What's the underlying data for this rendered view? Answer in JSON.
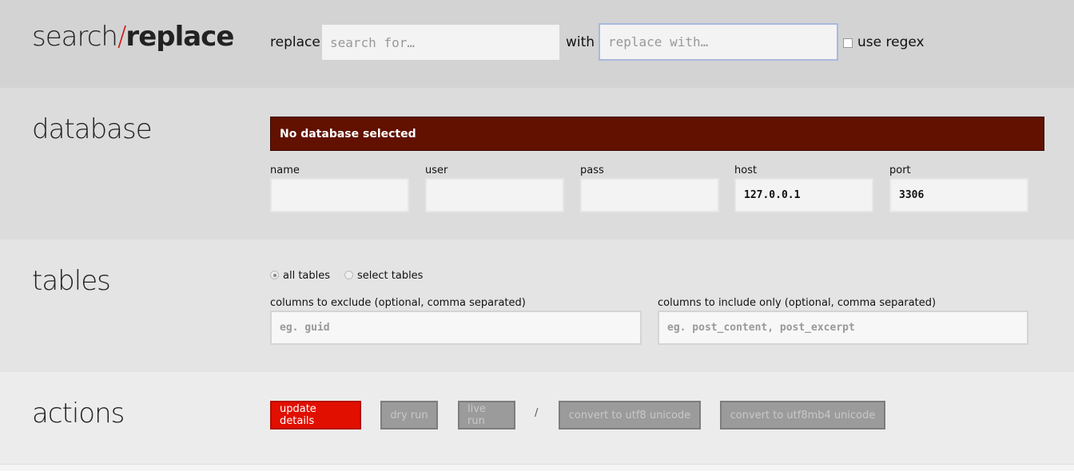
{
  "header": {
    "title_a": "search",
    "title_slash": "/",
    "title_b": "replace",
    "replace_label": "replace",
    "search_placeholder": "search for…",
    "with_label": "with",
    "replace_placeholder": "replace with…",
    "regex_label": "use regex"
  },
  "database": {
    "title": "database",
    "alert": "No database selected",
    "alert_color": "#621100",
    "fields": [
      {
        "label": "name",
        "value": ""
      },
      {
        "label": "user",
        "value": ""
      },
      {
        "label": "pass",
        "value": ""
      },
      {
        "label": "host",
        "value": "127.0.0.1"
      },
      {
        "label": "port",
        "value": "3306"
      }
    ]
  },
  "tables": {
    "title": "tables",
    "radio_all": "all tables",
    "radio_select": "select tables",
    "exclude_label": "columns to exclude (optional, comma separated)",
    "exclude_placeholder": "eg. guid",
    "include_label": "columns to include only (optional, comma separated)",
    "include_placeholder": "eg. post_content, post_excerpt"
  },
  "actions": {
    "title": "actions",
    "update": "update details",
    "dry": "dry run",
    "live": "live run",
    "sep": "/",
    "utf8": "convert to utf8 unicode",
    "utf8mb4": "convert to utf8mb4 unicode",
    "accent": "#e10f00"
  }
}
